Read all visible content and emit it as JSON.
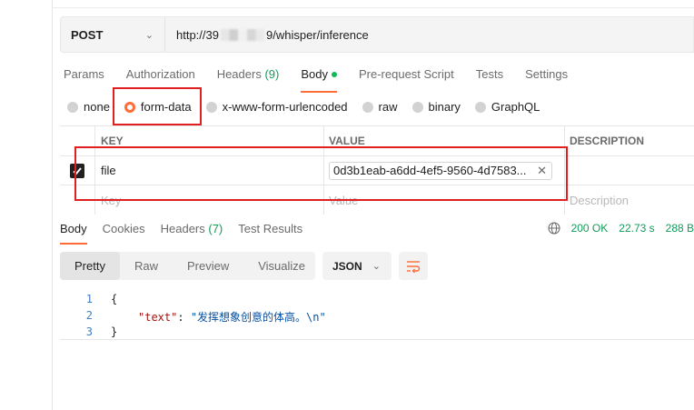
{
  "request": {
    "method": "POST",
    "url_prefix": "http://39",
    "url_suffix": "9/whisper/inference"
  },
  "request_tabs": [
    {
      "label": "Params"
    },
    {
      "label": "Authorization"
    },
    {
      "label": "Headers",
      "count": "(9)"
    },
    {
      "label": "Body"
    },
    {
      "label": "Pre-request Script"
    },
    {
      "label": "Tests"
    },
    {
      "label": "Settings"
    }
  ],
  "body_types": [
    "none",
    "form-data",
    "x-www-form-urlencoded",
    "raw",
    "binary",
    "GraphQL"
  ],
  "body_selected": "form-data",
  "table": {
    "headers": {
      "key": "KEY",
      "value": "VALUE",
      "description": "DESCRIPTION"
    },
    "rows": [
      {
        "checked": true,
        "key": "file",
        "value": "0d3b1eab-a6dd-4ef5-9560-4d7583...",
        "description": ""
      }
    ],
    "placeholders": {
      "key": "Key",
      "value": "Value",
      "description": "Description"
    }
  },
  "response_tabs": [
    {
      "label": "Body"
    },
    {
      "label": "Cookies"
    },
    {
      "label": "Headers",
      "count": "(7)"
    },
    {
      "label": "Test Results"
    }
  ],
  "response_status": {
    "status": "200 OK",
    "time": "22.73 s",
    "size": "288 B"
  },
  "view_modes": [
    "Pretty",
    "Raw",
    "Preview",
    "Visualize"
  ],
  "format": "JSON",
  "code": {
    "line_numbers": [
      "1",
      "2",
      "3"
    ],
    "open_brace": "{",
    "key": "\"text\"",
    "colon": ": ",
    "value": "\"发挥想象创意的体高。\\n\"",
    "close_brace": "}"
  },
  "colors": {
    "accent": "#ff6c37",
    "success": "#0f9d58",
    "highlight": "#e02020"
  }
}
